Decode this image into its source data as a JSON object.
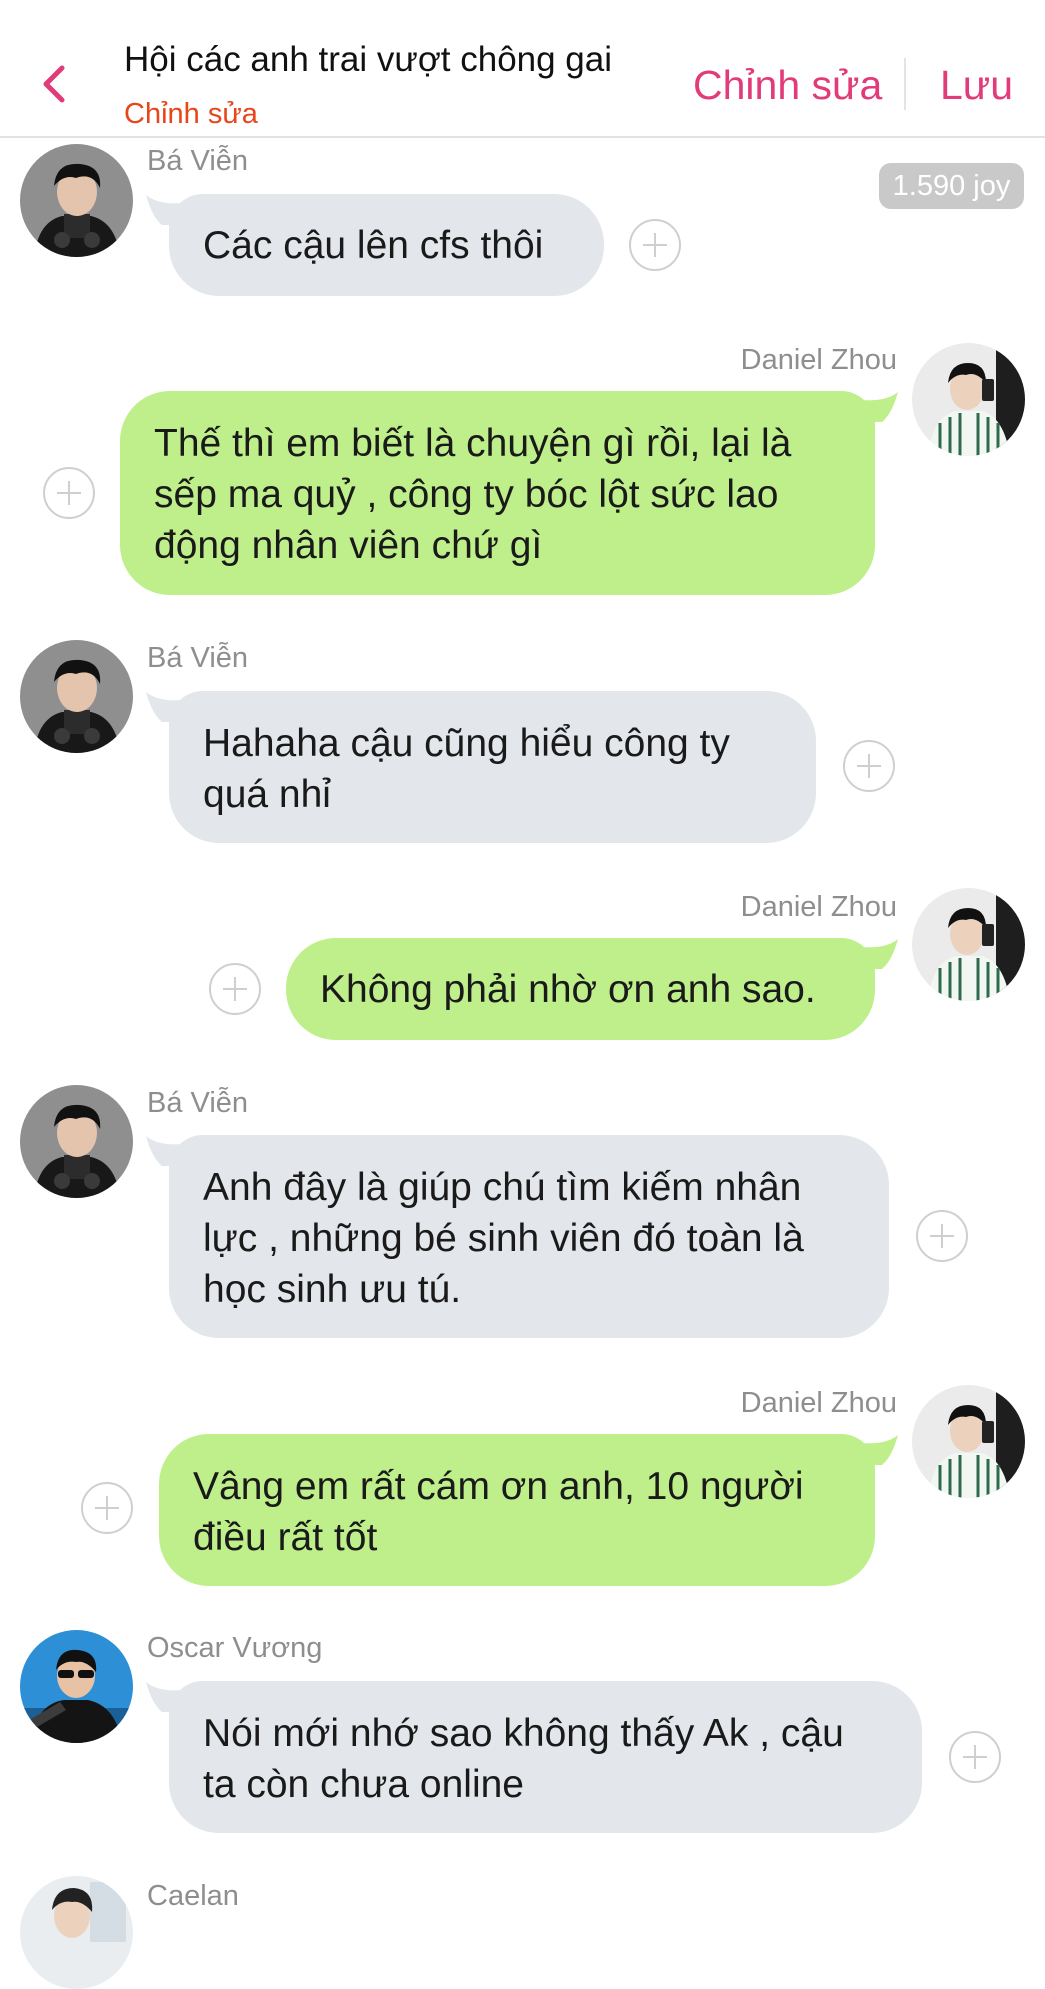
{
  "header": {
    "title": "Hội các anh trai vượt chông gai",
    "subtitle": "Chỉnh sửa",
    "edit_label": "Chỉnh sửa",
    "save_label": "Lưu",
    "back_icon": "chevron-left-icon",
    "accent_color": "#e23b7a",
    "subtitle_color": "#e8451a"
  },
  "joy_badge": "1.590 joy",
  "colors": {
    "incoming_bubble": "#e3e6ea",
    "outgoing_bubble": "#bfef8b"
  },
  "messages": [
    {
      "sender": "Bá Viễn",
      "side": "left",
      "lines": [
        "Các cậu lên cfs thôi"
      ]
    },
    {
      "sender": "Daniel Zhou",
      "side": "right",
      "lines": [
        "Thế thì em biết là chuyện gì rồi, lại là",
        "sếp ma quỷ , công ty bóc lột sức lao",
        "động nhân viên chứ gì"
      ]
    },
    {
      "sender": "Bá Viễn",
      "side": "left",
      "lines": [
        "Hahaha cậu cũng hiểu công ty",
        "quá nhỉ"
      ]
    },
    {
      "sender": "Daniel Zhou",
      "side": "right",
      "lines": [
        "Không phải nhờ ơn anh sao."
      ]
    },
    {
      "sender": "Bá Viễn",
      "side": "left",
      "lines": [
        "Anh đây là giúp chú tìm kiếm nhân",
        "lực , những bé sinh viên đó toàn là",
        "học sinh ưu tú."
      ]
    },
    {
      "sender": "Daniel Zhou",
      "side": "right",
      "lines": [
        "Vâng em rất cám ơn anh, 10 người",
        "điều rất tốt"
      ]
    },
    {
      "sender": "Oscar Vương",
      "side": "left",
      "lines": [
        "Nói mới nhớ sao không thấy Ak , cậu",
        "ta còn chưa online"
      ]
    },
    {
      "sender": "Caelan",
      "side": "left",
      "lines": []
    }
  ]
}
